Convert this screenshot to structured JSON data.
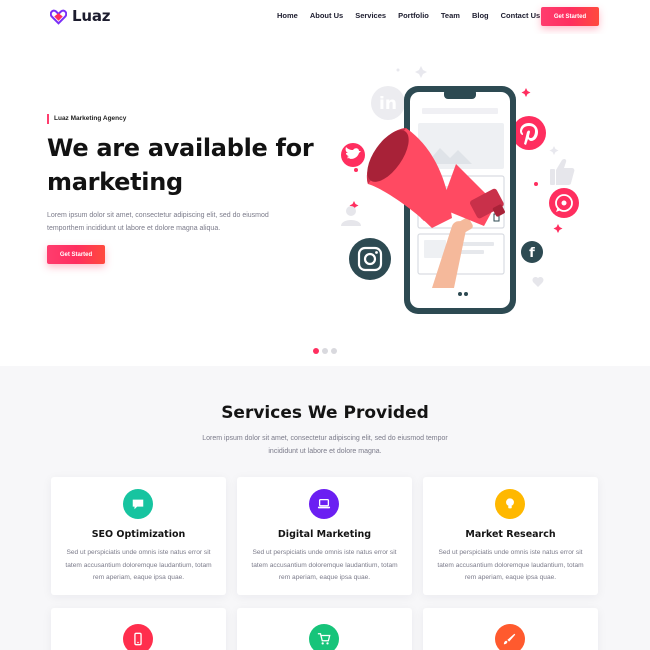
{
  "brand": {
    "name": "Luaz",
    "color": "#ff2e5f"
  },
  "nav": {
    "items": [
      "Home",
      "About Us",
      "Services",
      "Portfolio",
      "Team",
      "Blog",
      "Contact Us"
    ],
    "cta_label": "Get Started"
  },
  "hero": {
    "eyebrow": "Luaz Marketing Agency",
    "title": "We are available for marketing",
    "description": "Lorem ipsum dolor sit amet, consectetur adipiscing elit, sed do eiusmod temporthem incididunt ut labore et dolore magna aliqua.",
    "cta_label": "Get Started",
    "slider": {
      "count": 3,
      "active": 0
    },
    "illustration_icons": [
      "linkedin-icon",
      "twitter-icon",
      "pinterest-icon",
      "thumbs-up-icon",
      "whatsapp-icon",
      "facebook-icon",
      "instagram-icon",
      "user-icon",
      "megaphone-icon",
      "heart-icon"
    ]
  },
  "services": {
    "title": "Services We Provided",
    "description": "Lorem ipsum dolor sit amet, consectetur adipiscing elit, sed do eiusmod tempor incididunt ut labore et dolore magna.",
    "cards": [
      {
        "title": "SEO Optimization",
        "text": "Sed ut perspiciatis unde omnis iste natus error sit tatem accusantium doloremque laudantium, totam rem aperiam, eaque ipsa quae.",
        "icon": "chat-bubble-icon",
        "color": "#17c4a0"
      },
      {
        "title": "Digital Marketing",
        "text": "Sed ut perspiciatis unde omnis iste natus error sit tatem accusantium doloremque laudantium, totam rem aperiam, eaque ipsa quae.",
        "icon": "laptop-icon",
        "color": "#6b1ff2"
      },
      {
        "title": "Market Research",
        "text": "Sed ut perspiciatis unde omnis iste natus error sit tatem accusantium doloremque laudantium, totam rem aperiam, eaque ipsa quae.",
        "icon": "lightbulb-icon",
        "color": "#ffb800"
      },
      {
        "title": "",
        "text": "",
        "icon": "mobile-icon",
        "color": "#ff2e4d"
      },
      {
        "title": "",
        "text": "",
        "icon": "cart-icon",
        "color": "#17c47a"
      },
      {
        "title": "",
        "text": "",
        "icon": "brush-icon",
        "color": "#ff5a2e"
      }
    ]
  }
}
